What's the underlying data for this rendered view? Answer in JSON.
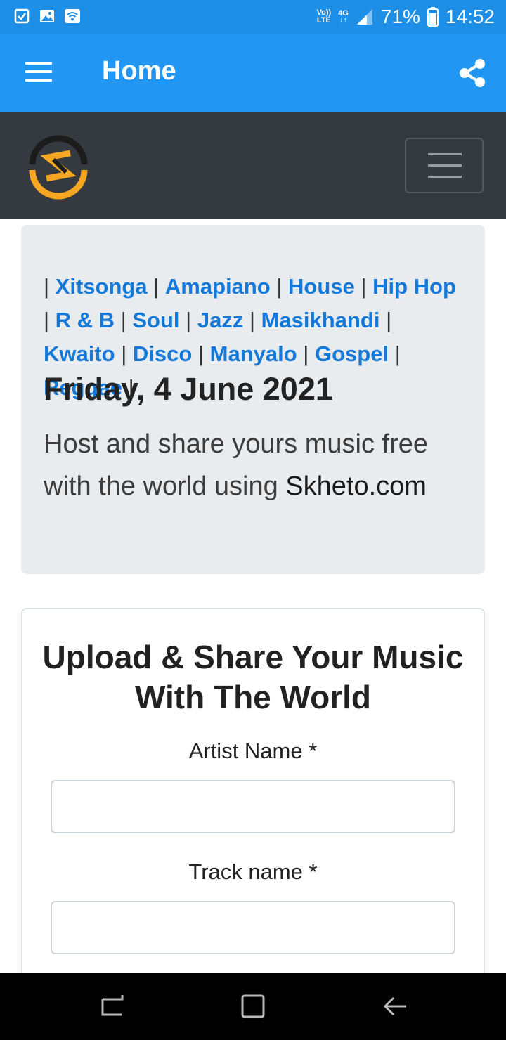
{
  "status_bar": {
    "volte_top": "Vo))",
    "volte_bottom": "LTE",
    "network_top": "4G",
    "network_bottom": "↓↑",
    "battery_percent": "71%",
    "time": "14:52",
    "icons": [
      "checklist-icon",
      "image-icon",
      "wifi-icon",
      "signal-icon",
      "battery-icon"
    ]
  },
  "app_bar": {
    "title": "Home",
    "color": "#2196f3"
  },
  "site_nav": {
    "logo_colors": [
      "#f5a623",
      "#1c1c1c"
    ]
  },
  "jumbotron": {
    "separator": "|",
    "genres": [
      "Xitsonga",
      "Amapiano",
      "House",
      "Hip Hop",
      "R & B",
      "Soul",
      "Jazz",
      "Masikhandi",
      "Kwaito",
      "Disco",
      "Manyalo",
      "Gospel",
      "Reggae"
    ],
    "date": "Friday, 4 June 2021",
    "lead_text": "Host and share yours music free with the world using",
    "lead_domain": "Skheto.com"
  },
  "upload_form": {
    "title": "Upload & Share Your Music With The World",
    "artist_label": "Artist Name *",
    "artist_value": "",
    "track_label": "Track name *",
    "track_value": ""
  }
}
